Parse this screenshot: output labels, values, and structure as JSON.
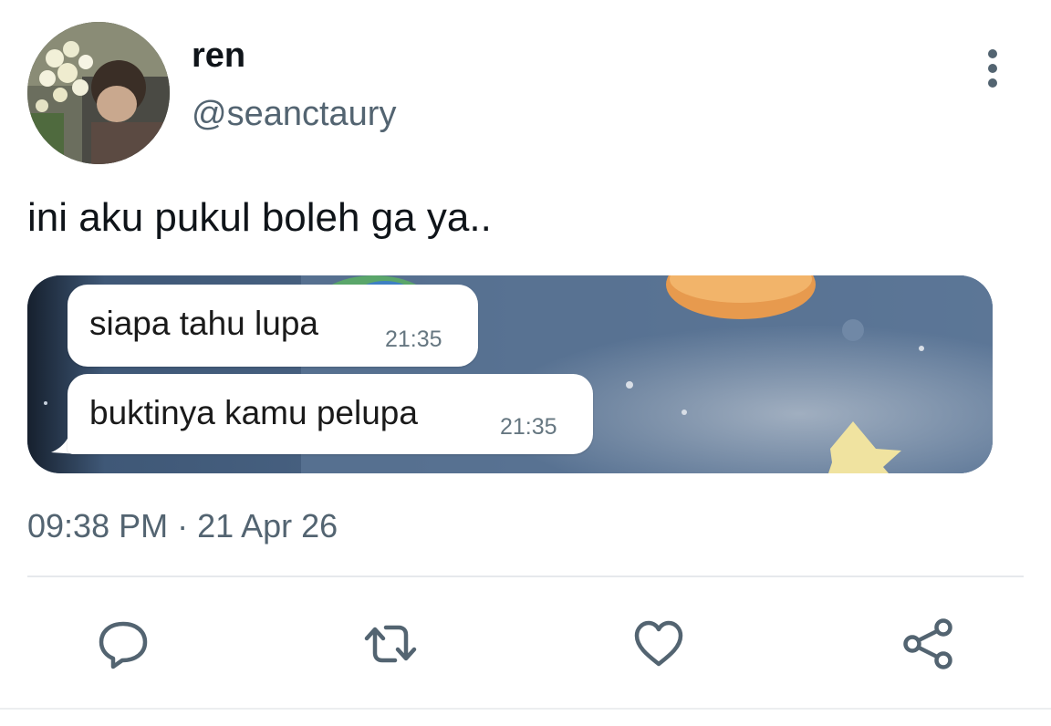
{
  "author": {
    "display_name": "ren",
    "handle": "@seanctaury"
  },
  "tweet": {
    "text": "ini aku pukul boleh ga ya..",
    "timestamp": "09:38 PM · 21 Apr 26"
  },
  "media": {
    "messages": [
      {
        "text": "siapa tahu lupa",
        "time": "21:35"
      },
      {
        "text": "buktinya kamu pelupa",
        "time": "21:35"
      }
    ]
  },
  "icons": {
    "more": "more-vertical-icon",
    "reply": "reply-icon",
    "retweet": "retweet-icon",
    "like": "heart-icon",
    "share": "share-icon"
  },
  "colors": {
    "primary_text": "#0f1419",
    "secondary_text": "#536471",
    "icon": "#536471",
    "divider": "#e6e9ec"
  }
}
